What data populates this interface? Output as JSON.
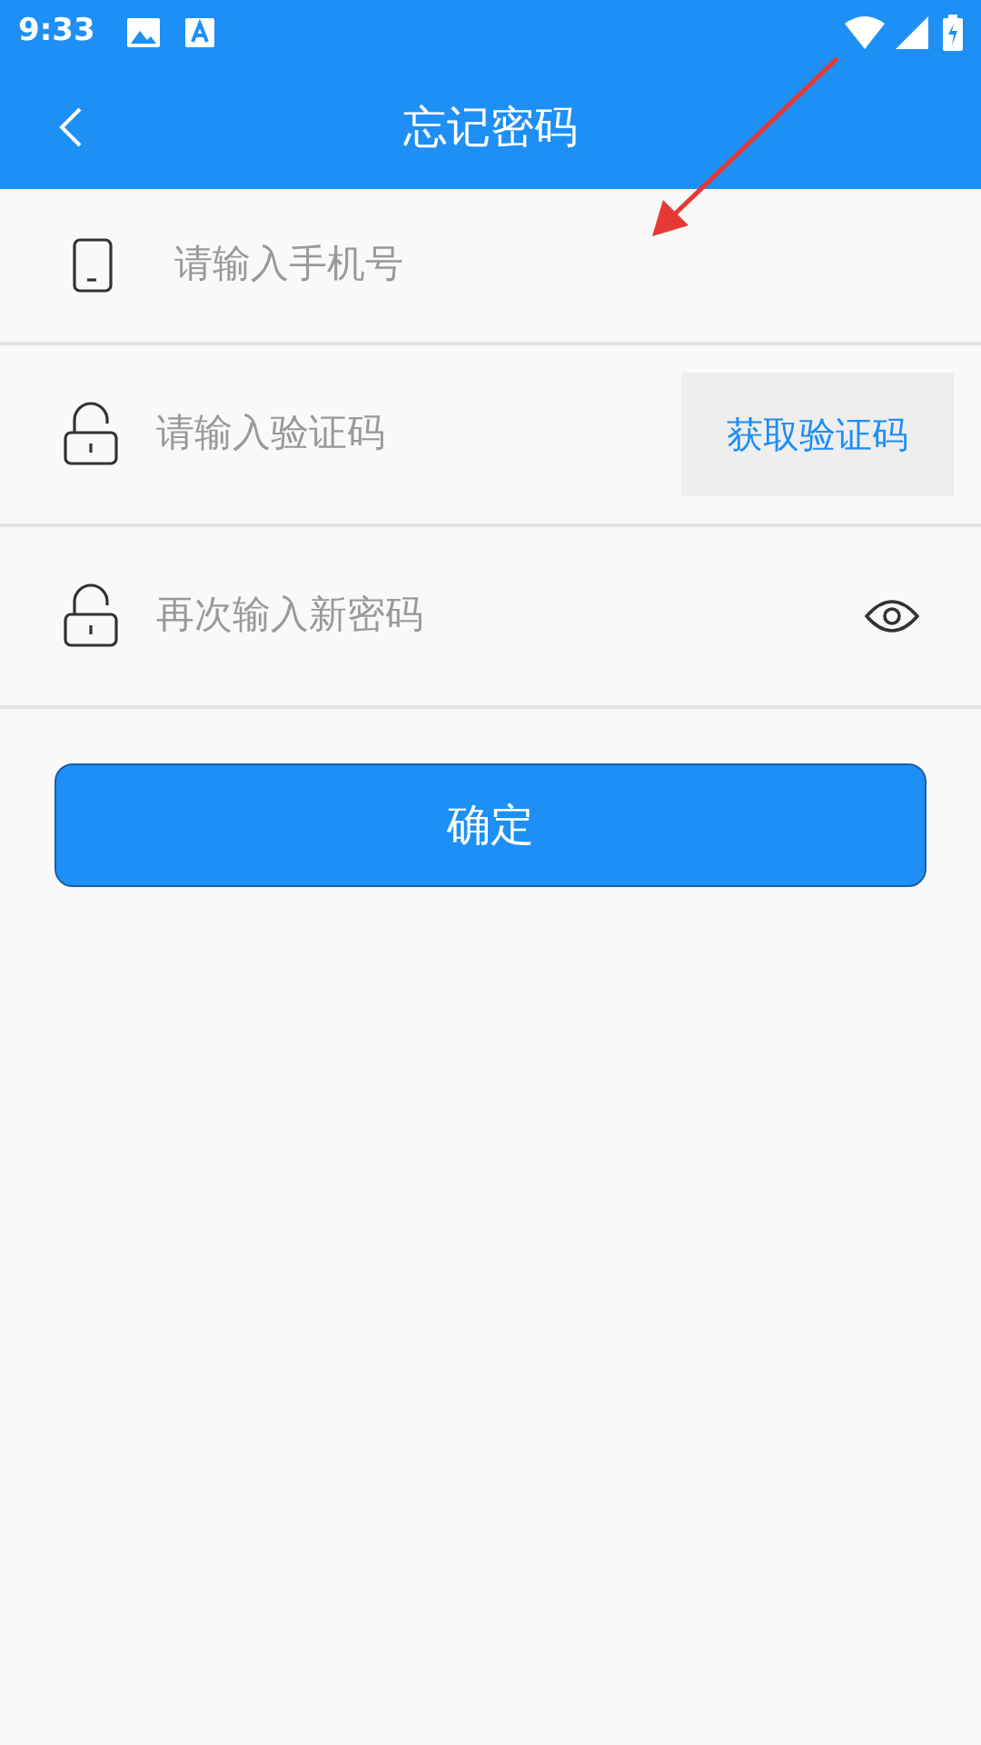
{
  "status_bar": {
    "time": "9:33"
  },
  "header": {
    "title": "忘记密码"
  },
  "fields": [
    {
      "kind": "phone",
      "placeholder": "请输入手机号"
    },
    {
      "kind": "code",
      "placeholder": "请输入验证码",
      "action": "获取验证码"
    },
    {
      "kind": "password",
      "placeholder": "再次输入新密码"
    }
  ],
  "submit": "确定"
}
